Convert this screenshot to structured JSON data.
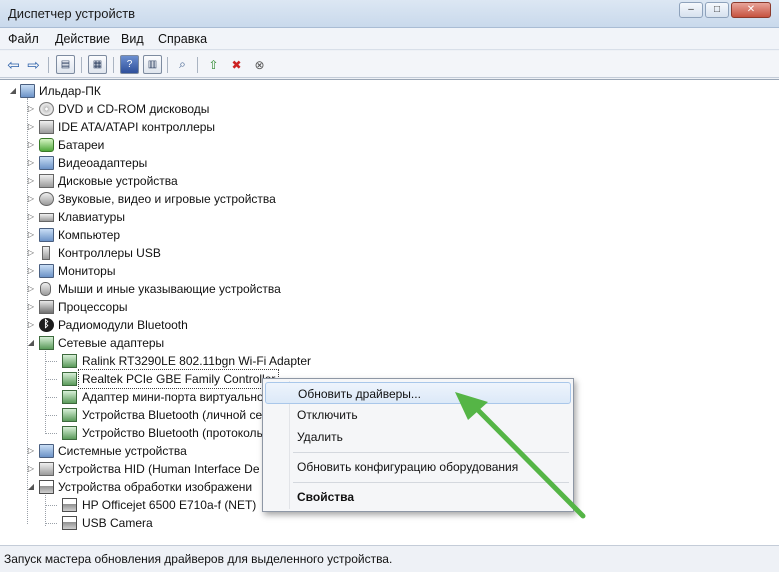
{
  "window": {
    "title": "Диспетчер устройств",
    "minimize_glyph": "–",
    "maximize_glyph": "□",
    "close_glyph": "✕"
  },
  "menu": [
    "Файл",
    "Действие",
    "Вид",
    "Справка"
  ],
  "toolbar": {
    "icons": [
      "back-arrow-icon",
      "forward-arrow-icon",
      "show-hide-console-tree-icon",
      "properties-icon",
      "help-icon",
      "action-pane-icon",
      "scan-hardware-icon",
      "update-driver-icon",
      "disable-device-icon",
      "uninstall-device-icon"
    ],
    "back_glyph": "⇦",
    "forward_glyph": "⇨",
    "help_glyph": "?"
  },
  "tree": {
    "root": "Ильдар-ПК",
    "categories": [
      "DVD и CD-ROM дисководы",
      "IDE ATA/ATAPI контроллеры",
      "Батареи",
      "Видеоадаптеры",
      "Дисковые устройства",
      "Звуковые, видео и игровые устройства",
      "Клавиатуры",
      "Компьютер",
      "Контроллеры USB",
      "Мониторы",
      "Мыши и иные указывающие устройства",
      "Процессоры",
      "Радиомодули Bluetooth",
      "Сетевые адаптеры"
    ],
    "network_adapters": [
      "Ralink RT3290LE 802.11bgn Wi-Fi Adapter",
      "Realtek PCIe GBE Family Controller",
      "Адаптер мини-порта виртуально",
      "Устройства Bluetooth (личной се",
      "Устройство Bluetooth (протоколь"
    ],
    "after_categories": [
      "Системные устройства",
      "Устройства HID (Human Interface De",
      "Устройства обработки изображени"
    ],
    "imaging_devices": [
      "HP Officejet 6500 E710a-f (NET)",
      "USB Camera"
    ],
    "collapsed_glyph": "▷",
    "expanded_glyph": "◢",
    "bluetooth_glyph": "ᛒ"
  },
  "context_menu": {
    "update_drivers": "Обновить драйверы...",
    "disable": "Отключить",
    "uninstall": "Удалить",
    "scan_hardware": "Обновить конфигурацию оборудования",
    "properties": "Свойства"
  },
  "status_bar": "Запуск мастера обновления драйверов для выделенного устройства.",
  "colors": {
    "arrow": "#55b546",
    "selection_border": "#a9c7ea"
  }
}
